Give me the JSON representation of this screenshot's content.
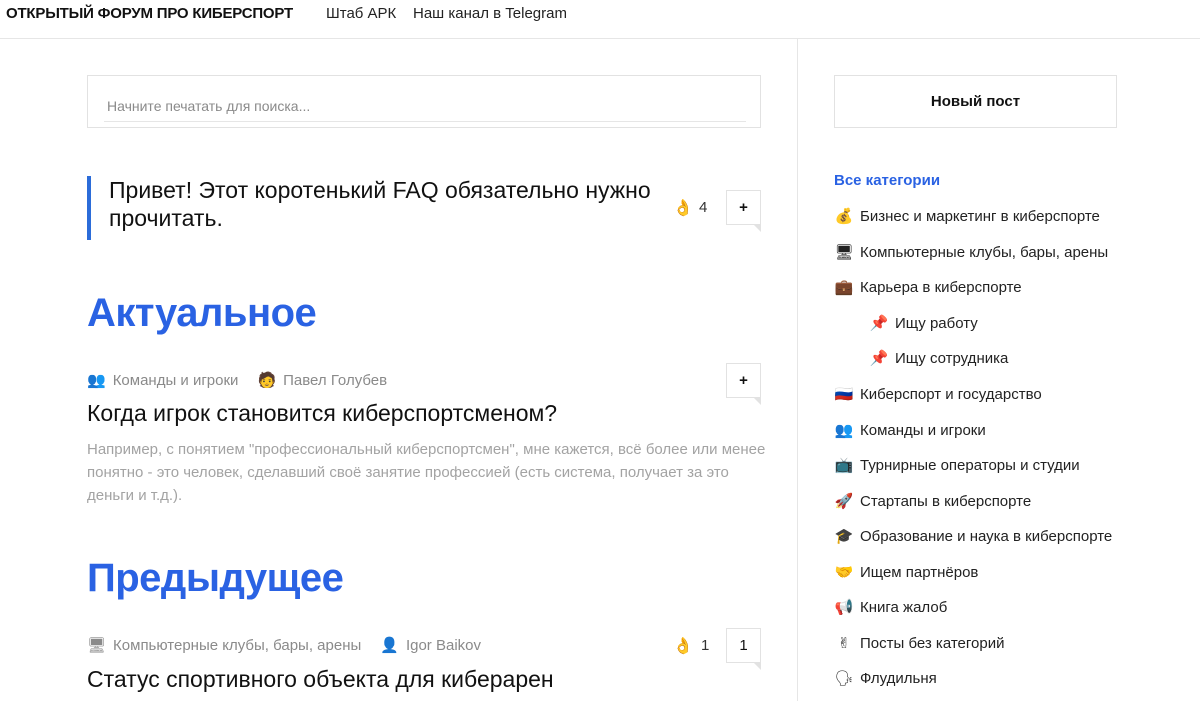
{
  "header": {
    "brand": "ОТКРЫТЫЙ ФОРУМ ПРО КИБЕРСПОРТ",
    "nav": [
      "Штаб АРК",
      "Наш канал в Telegram"
    ]
  },
  "search": {
    "placeholder": "Начните печатать для поиска..."
  },
  "pinned": {
    "title": "Привет! Этот коротенький FAQ обязательно нужно прочитать.",
    "reactions": "4",
    "action_label": "+"
  },
  "sections": {
    "current": "Актуальное",
    "previous": "Предыдущее"
  },
  "current_post": {
    "category": "Команды и игроки",
    "category_icon": "👥",
    "author": "Павел Голубев",
    "author_icon": "🧑",
    "title": "Когда игрок становится киберспортсменом?",
    "excerpt": "Например, с понятием \"профессиональный киберспортсмен\", мне кажется, всё более или менее понятно - это человек, сделавший своё занятие профессией (есть система, получает за это деньги и т.д.).",
    "action_label": "+"
  },
  "previous_post": {
    "category": "Компьютерные клубы, бары, арены",
    "category_icon": "🖥",
    "author": "Igor Baikov",
    "author_icon": "👤",
    "title": "Статус спортивного объекта для киберарен",
    "reactions": "1",
    "comments": "1"
  },
  "sidebar": {
    "new_post_label": "Новый пост",
    "all_categories": "Все категории",
    "categories": [
      {
        "icon": "💰",
        "label": "Бизнес и маркетинг в киберспорте"
      },
      {
        "icon": "🖥",
        "label": "Компьютерные клубы, бары, арены"
      },
      {
        "icon": "💼",
        "label": "Карьера в киберспорте"
      },
      {
        "icon": "📌",
        "label": "Ищу работу"
      },
      {
        "icon": "📌",
        "label": "Ищу сотрудника"
      },
      {
        "icon": "🇷🇺",
        "label": "Киберспорт и государство"
      },
      {
        "icon": "👥",
        "label": "Команды и игроки"
      },
      {
        "icon": "📺",
        "label": "Турнирные операторы и студии"
      },
      {
        "icon": "🚀",
        "label": "Стартапы в киберспорте"
      },
      {
        "icon": "🎓",
        "label": "Образование и наука в киберспорте"
      },
      {
        "icon": "🤝",
        "label": "Ищем партнёров"
      },
      {
        "icon": "📢",
        "label": "Книга жалоб"
      },
      {
        "icon": "✌",
        "label": "Посты без категорий"
      },
      {
        "icon": "🗣",
        "label": "Флудильня"
      }
    ]
  },
  "colors": {
    "accent": "#2a62e3",
    "pinned_bar": "#2b6cd9",
    "muted_text": "#8a8a8a",
    "border": "#e2e2e2"
  }
}
